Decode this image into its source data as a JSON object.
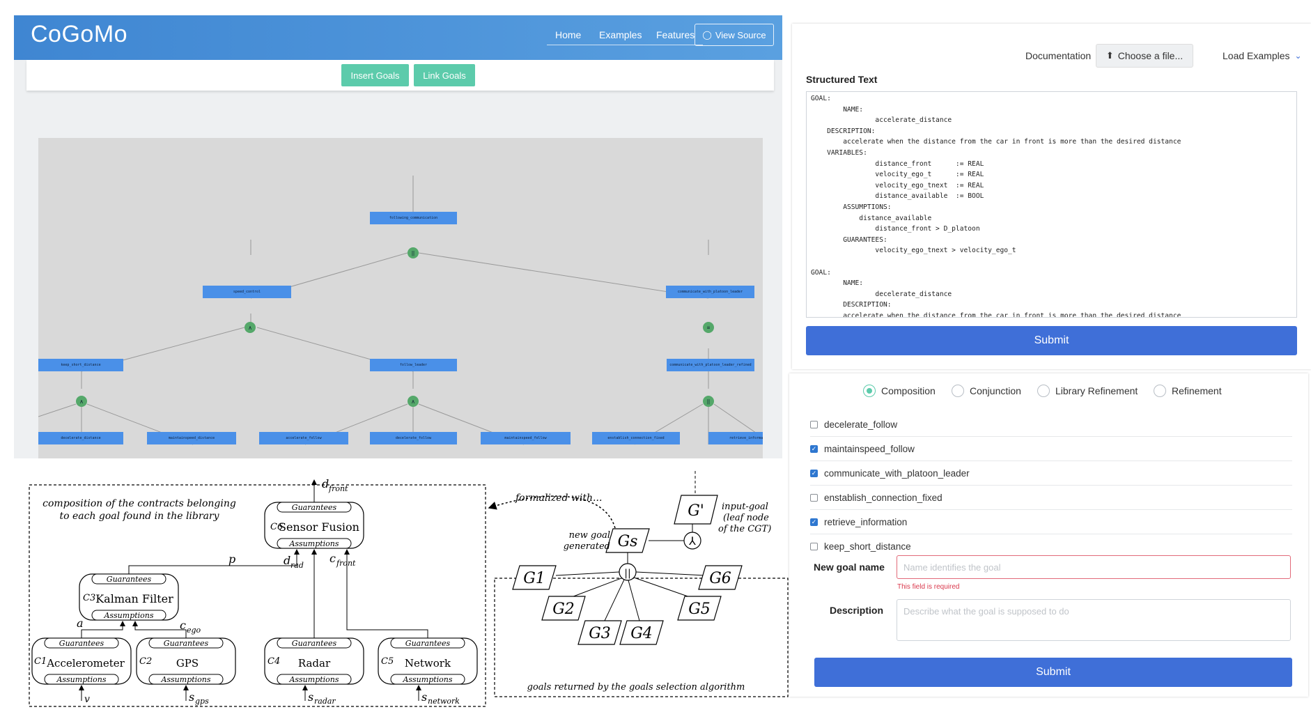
{
  "navbar": {
    "brand": "CoGoMo",
    "links": [
      "Home",
      "Examples",
      "Features"
    ],
    "view_source": "View Source"
  },
  "toolbar": {
    "insert_goals": "Insert Goals",
    "link_goals": "Link Goals"
  },
  "graph": {
    "nodes": [
      "following_communication",
      "speed_control",
      "communicate_with_platoon_leader",
      "keep_short_distance",
      "follow_leader",
      "communicate_with_platoon_leader_refined",
      "decelerate_distance",
      "maintainspeed_distance",
      "accelerate_follow",
      "decelerate_follow",
      "maintainspeed_follow",
      "enstablish_connection_fixed",
      "retrieve_information"
    ],
    "operators": [
      "||",
      "∧",
      "≡",
      "∧",
      "∧",
      "||"
    ]
  },
  "right_top": {
    "documentation": "Documentation",
    "choose_file": "Choose a file...",
    "load_examples": "Load Examples",
    "structured_text_label": "Structured Text",
    "structured_text": "GOAL:\n        NAME:\n                accelerate_distance\n    DESCRIPTION:\n        accelerate when the distance from the car in front is more than the desired distance\n    VARIABLES:\n                distance_front      := REAL\n                velocity_ego_t      := REAL\n                velocity_ego_tnext  := REAL\n                distance_available  := BOOL\n        ASSUMPTIONS:\n            distance_available\n                distance_front > D_platoon\n        GUARANTEES:\n                velocity_ego_tnext > velocity_ego_t\n\nGOAL:\n        NAME:\n                decelerate_distance\n        DESCRIPTION:\n        accelerate when the distance from the car in front is more than the desired distance",
    "submit": "Submit"
  },
  "right_bottom": {
    "radios": [
      {
        "label": "Composition",
        "selected": true
      },
      {
        "label": "Conjunction",
        "selected": false
      },
      {
        "label": "Library Refinement",
        "selected": false
      },
      {
        "label": "Refinement",
        "selected": false
      }
    ],
    "goals": [
      {
        "label": "decelerate_follow",
        "checked": false
      },
      {
        "label": "maintainspeed_follow",
        "checked": true
      },
      {
        "label": "communicate_with_platoon_leader",
        "checked": true
      },
      {
        "label": "enstablish_connection_fixed",
        "checked": false
      },
      {
        "label": "retrieve_information",
        "checked": true
      },
      {
        "label": "keep_short_distance",
        "checked": false
      }
    ],
    "new_goal_label": "New goal name",
    "new_goal_placeholder": "Name identifies the goal",
    "new_goal_error": "This field is required",
    "description_label": "Description",
    "description_placeholder": "Describe what the goal is supposed to do",
    "submit": "Submit"
  },
  "diagram": {
    "library_note": [
      "composition of the contracts belonging",
      "to each goal found in the library"
    ],
    "formalized": "formalized with...",
    "new_goal": [
      "new goal",
      "generated"
    ],
    "input_goal": [
      "input-goal",
      "(leaf node",
      "of the CGT)"
    ],
    "selection_caption": "goals returned by the goals selection algorithm",
    "components": [
      "Sensor Fusion",
      "Kalman Filter",
      "Accelerometer",
      "GPS",
      "Radar",
      "Network"
    ],
    "component_ids": [
      "C6",
      "C3",
      "C1",
      "C2",
      "C4",
      "C5"
    ],
    "guarantees": "Guarantees",
    "assumptions": "Assumptions",
    "signals": [
      "d",
      "front",
      "p",
      "d",
      "rad",
      "c",
      "front",
      "a",
      "c",
      "ego",
      "v",
      "s",
      "gps",
      "s",
      "radar",
      "s",
      "network"
    ],
    "goals": [
      "G'",
      "Gs",
      "G1",
      "G2",
      "G3",
      "G4",
      "G5",
      "G6"
    ]
  }
}
